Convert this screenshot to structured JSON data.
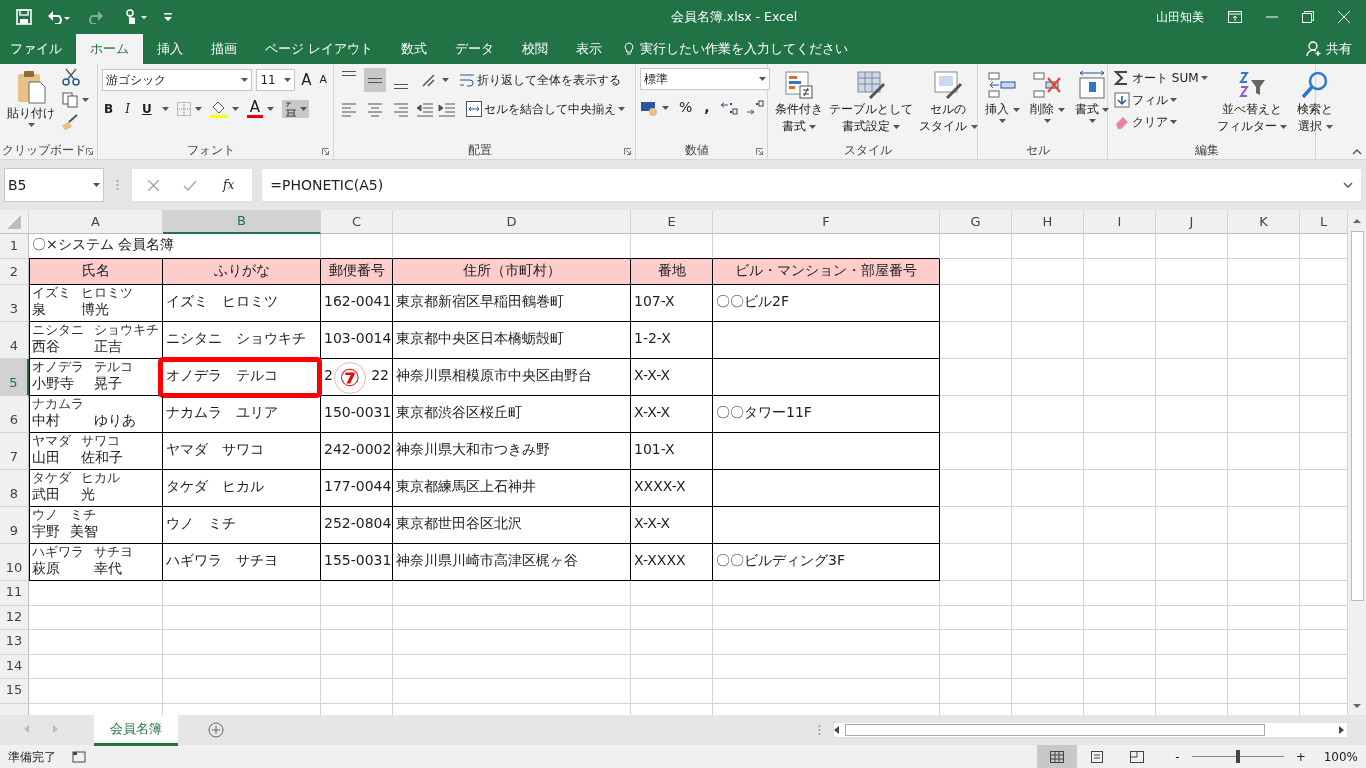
{
  "window": {
    "title": "会員名簿.xlsx  -  Excel",
    "user": "山田知美"
  },
  "tabs": [
    {
      "label": "ファイル",
      "selected": false
    },
    {
      "label": "ホーム",
      "selected": true
    },
    {
      "label": "挿入",
      "selected": false
    },
    {
      "label": "描画",
      "selected": false
    },
    {
      "label": "ページ レイアウト",
      "selected": false
    },
    {
      "label": "数式",
      "selected": false
    },
    {
      "label": "データ",
      "selected": false
    },
    {
      "label": "校閲",
      "selected": false
    },
    {
      "label": "表示",
      "selected": false
    }
  ],
  "tell_me": {
    "placeholder": "実行したい作業を入力してください"
  },
  "share": "共有",
  "ribbon": {
    "clipboard": {
      "label": "クリップボード",
      "paste": "貼り付け"
    },
    "font": {
      "label": "フォント",
      "font_name": "游ゴシック",
      "font_size": "11",
      "grow": "A",
      "shrink": "A",
      "bold": "B",
      "italic": "I",
      "underline": "U",
      "font_color": "A",
      "furigana_active": true
    },
    "alignment": {
      "label": "配置",
      "vertical": [
        {
          "selected": false
        },
        {
          "selected": true
        },
        {
          "selected": false
        }
      ],
      "wrap": "折り返して全体を表示する",
      "merge": "セルを結合して中央揃え"
    },
    "number": {
      "label": "数値",
      "format": "標準",
      "percent": "%",
      "comma": ","
    },
    "styles": {
      "label": "スタイル",
      "buttons": [
        {
          "lines": [
            "条件付き",
            "書式"
          ]
        },
        {
          "lines": [
            "テーブルとして",
            "書式設定"
          ]
        },
        {
          "lines": [
            "セルの",
            "スタイル"
          ]
        }
      ]
    },
    "cells": {
      "label": "セル",
      "buttons": [
        {
          "lines": [
            "挿入"
          ]
        },
        {
          "lines": [
            "削除"
          ]
        },
        {
          "lines": [
            "書式"
          ]
        }
      ]
    },
    "editing": {
      "label": "編集",
      "small": [
        "オート SUM",
        "フィル",
        "クリア"
      ],
      "buttons": [
        {
          "lines": [
            "並べ替えと",
            "フィルター"
          ]
        },
        {
          "lines": [
            "検索と",
            "選択"
          ]
        }
      ]
    }
  },
  "formula_bar": {
    "name_box": "B5",
    "fx": "fx",
    "formula": "=PHONETIC(A5)"
  },
  "columns": [
    {
      "label": "A",
      "selected": false
    },
    {
      "label": "B",
      "selected": true
    },
    {
      "label": "C",
      "selected": false
    },
    {
      "label": "D",
      "selected": false
    },
    {
      "label": "E",
      "selected": false
    },
    {
      "label": "F",
      "selected": false
    },
    {
      "label": "G",
      "selected": false
    },
    {
      "label": "H",
      "selected": false
    },
    {
      "label": "I",
      "selected": false
    },
    {
      "label": "J",
      "selected": false
    },
    {
      "label": "K",
      "selected": false
    },
    {
      "label": "L",
      "selected": false
    }
  ],
  "rows": [
    {
      "number": "1",
      "selected": false,
      "kind": "title",
      "text": "〇×システム 会員名簿"
    },
    {
      "number": "2",
      "selected": false,
      "kind": "header",
      "cells": [
        "氏名",
        "ふりがな",
        "郵便番号",
        "住所（市町村）",
        "番地",
        "ビル・マンション・部屋番号"
      ]
    },
    {
      "number": "3",
      "selected": false,
      "kind": "record",
      "name": [
        {
          "kanji": "泉",
          "kana": "イズミ"
        },
        {
          "kanji": "博光",
          "kana": "ヒロミツ"
        }
      ],
      "furigana": "イズミ　ヒロミツ",
      "postal": [
        "162-0041"
      ],
      "address": "東京都新宿区早稲田鶴巻町",
      "block": "107-X",
      "building": "〇〇ビル2F"
    },
    {
      "number": "4",
      "selected": false,
      "kind": "record",
      "name": [
        {
          "kanji": "西谷",
          "kana": "ニシタニ"
        },
        {
          "kanji": "正吉",
          "kana": "ショウキチ"
        }
      ],
      "furigana": "ニシタニ　ショウキチ",
      "postal": [
        "103-0014"
      ],
      "address": "東京都中央区日本橋蛎殻町",
      "block": "1-2-X"
    },
    {
      "number": "5",
      "selected": true,
      "kind": "record",
      "name": [
        {
          "kanji": "小野寺",
          "kana": "オノデラ"
        },
        {
          "kanji": "晃子",
          "kana": "テルコ"
        }
      ],
      "furigana": "オノデラ　テルコ",
      "postal": [
        "2",
        "22"
      ],
      "address": "神奈川県相模原市中央区由野台",
      "block": "X-X-X",
      "callout": {
        "marker": "⑦"
      }
    },
    {
      "number": "6",
      "selected": false,
      "kind": "record",
      "name": [
        {
          "kanji": "中村",
          "kana": "ナカムラ"
        },
        {
          "kanji": "ゆりあ"
        }
      ],
      "furigana": "ナカムラ　ユリア",
      "postal": [
        "150-0031"
      ],
      "address": "東京都渋谷区桜丘町",
      "block": "X-X-X",
      "building": "〇〇タワー11F"
    },
    {
      "number": "7",
      "selected": false,
      "kind": "record",
      "name": [
        {
          "kanji": "山田",
          "kana": "ヤマダ"
        },
        {
          "kanji": "佐和子",
          "kana": "サワコ"
        }
      ],
      "furigana": "ヤマダ　サワコ",
      "postal": [
        "242-0002"
      ],
      "address": "神奈川県大和市つきみ野",
      "block": "101-X"
    },
    {
      "number": "8",
      "selected": false,
      "kind": "record",
      "name": [
        {
          "kanji": "武田",
          "kana": "タケダ"
        },
        {
          "kanji": "光",
          "kana": "ヒカル"
        }
      ],
      "furigana": "タケダ　ヒカル",
      "postal": [
        "177-0044"
      ],
      "address": "東京都練馬区上石神井",
      "block": "XXXX-X"
    },
    {
      "number": "9",
      "selected": false,
      "kind": "record",
      "name": [
        {
          "kanji": "宇野",
          "kana": "ウノ"
        },
        {
          "kanji": "美智",
          "kana": "ミチ"
        }
      ],
      "furigana": "ウノ　ミチ",
      "postal": [
        "252-0804"
      ],
      "address": "東京都世田谷区北沢",
      "block": "X-X-X"
    },
    {
      "number": "10",
      "selected": false,
      "kind": "record",
      "name": [
        {
          "kanji": "萩原",
          "kana": "ハギワラ"
        },
        {
          "kanji": "幸代",
          "kana": "サチヨ"
        }
      ],
      "furigana": "ハギワラ　サチヨ",
      "postal": [
        "155-0031"
      ],
      "address": "神奈川県川崎市高津区梶ヶ谷",
      "block": "X-XXXX",
      "building": "〇〇ビルディング3F"
    },
    {
      "number": "11",
      "selected": false,
      "kind": "empty"
    },
    {
      "number": "12",
      "selected": false,
      "kind": "empty"
    },
    {
      "number": "13",
      "selected": false,
      "kind": "empty"
    },
    {
      "number": "14",
      "selected": false,
      "kind": "empty"
    },
    {
      "number": "15",
      "selected": false,
      "kind": "empty"
    }
  ],
  "sheet_tabs": [
    {
      "label": "会員名簿",
      "selected": true
    }
  ],
  "status_bar": {
    "status": "準備完了",
    "zoom_out": "-",
    "zoom_in": "+",
    "zoom": "100%",
    "level": 0.5,
    "views": [
      {
        "selected": true
      },
      {
        "selected": false
      },
      {
        "selected": false
      }
    ]
  }
}
